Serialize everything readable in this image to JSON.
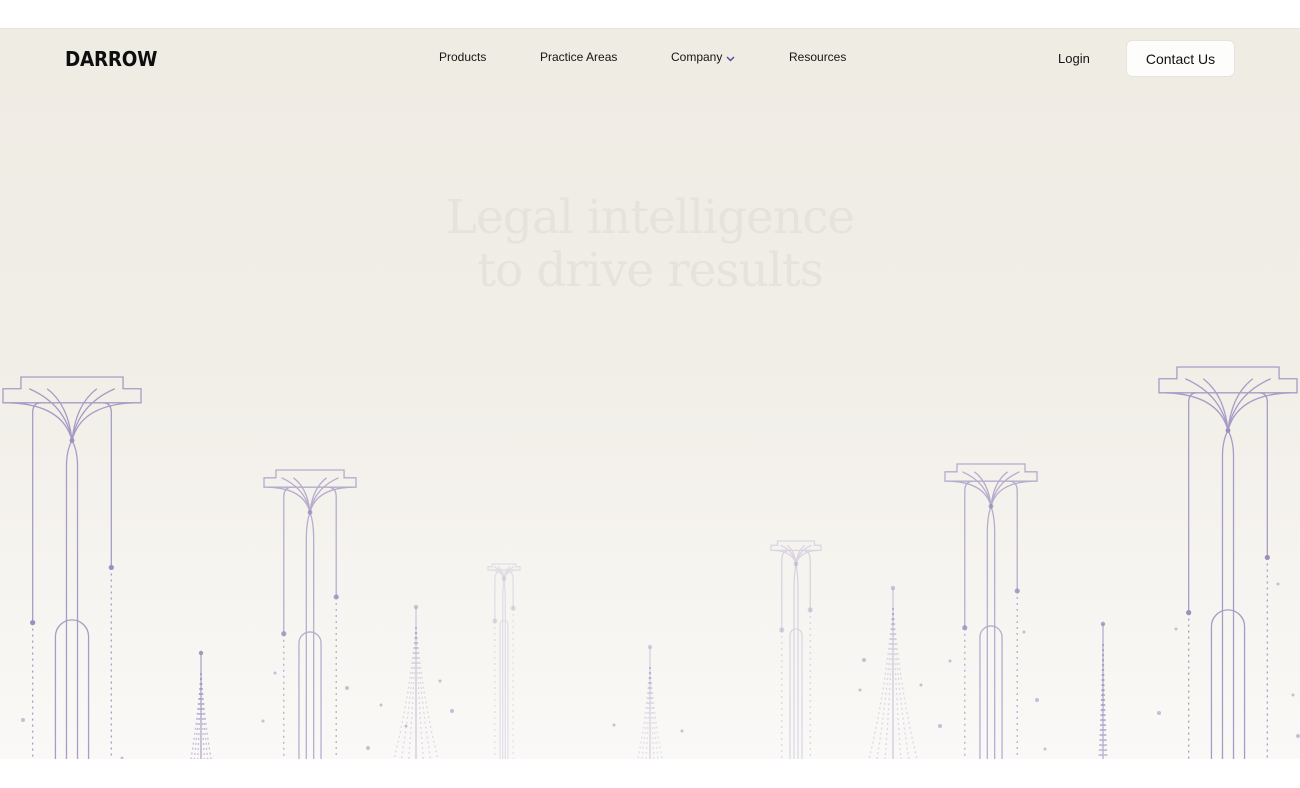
{
  "brand": {
    "logo_text": "DARROW"
  },
  "nav": {
    "items": [
      {
        "label": "Products"
      },
      {
        "label": "Practice Areas"
      },
      {
        "label": "Company",
        "has_dropdown": true
      },
      {
        "label": "Resources"
      }
    ],
    "login_label": "Login",
    "contact_label": "Contact Us"
  },
  "hero": {
    "headline_line1": "Legal intelligence",
    "headline_line2": "to drive results"
  },
  "colors": {
    "hero_bg": "#efece4",
    "line_accent": "#9b8fbd",
    "dropdown_chevron": "#5b3fa0"
  },
  "icons": {
    "dropdown": "chevron-down-icon"
  }
}
